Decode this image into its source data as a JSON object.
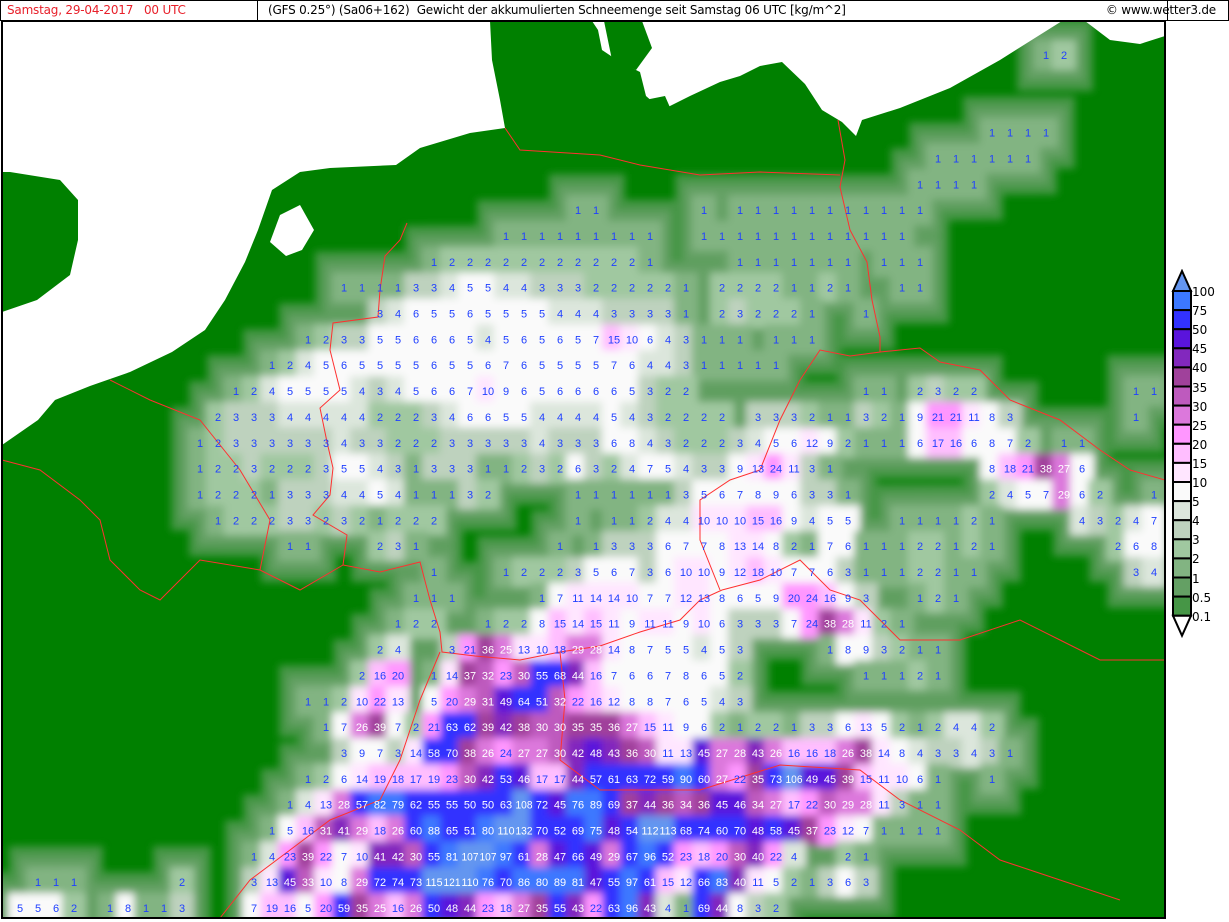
{
  "header": {
    "date": "Samstag, 29-04-2017   00 UTC",
    "title": "(GFS 0.25°) (Sa06+162)  Gewicht der akkumulierten Schneemenge seit Samstag 06 UTC [kg/m^2]",
    "copyright": "© www.wetter3.de"
  },
  "colors": {
    "land": "#008000",
    "sea": "#ffffff",
    "border": "#ff3030",
    "value_text": "#2040ff",
    "value_text_dark_bg": "#ffffff"
  },
  "legend": {
    "labels": [
      "100",
      "75",
      "50",
      "45",
      "40",
      "35",
      "30",
      "25",
      "20",
      "15",
      "10",
      "5",
      "4",
      "3",
      "2",
      "1",
      "0.5",
      "0.1"
    ],
    "thresholds": [
      0.1,
      0.5,
      1,
      2,
      3,
      4,
      5,
      10,
      15,
      20,
      25,
      30,
      35,
      40,
      45,
      50,
      75,
      100
    ],
    "class_colors": [
      "#469646",
      "#64a064",
      "#82b482",
      "#a0c8a0",
      "#bed2be",
      "#dce6dc",
      "#fafafa",
      "#ffe6ff",
      "#ffbeff",
      "#ff96ff",
      "#dc78dc",
      "#be5abe",
      "#a0419b",
      "#8228be",
      "#5a14dc",
      "#3232ff",
      "#3c78ff",
      "#6496f0"
    ],
    "below_min_color": "#ffffff",
    "unit": "kg/m^2"
  },
  "grid": {
    "note": "snow mass values per model grid cell, row by row north to south; ~N = N empty cells",
    "rows": [
      "~58 1 2",
      "",
      "",
      "~55 1 1 1 1",
      "~52 1 1 1 1 1 1",
      "~51 1 1 1 1",
      "~32 1 1 ~5 1 ~1 1 1 1 1 1 1 1 1 1 1 1",
      "~28 1 1 1 1 1 1 1 1 1 ~2 1 1 1 1 1 1 1 1 1 1 1 1",
      "~24 1 2 2 2 2 2 2 2 2 2 2 2 1 ~4 1 1 1 1 1 1 1 ~1 1 1 1",
      "~19 1 1 1 1 3 3 4 5 5 4 4 3 3 3 2 2 2 2 2 1 ~1 2 2 2 2 1 1 2 1 ~2 1 1",
      "~21 3 4 6 5 5 6 5 5 5 5 4 4 4 3 3 3 3 1 ~1 2 3 2 2 2 1 ~2 1",
      "~17 1 2 3 3 5 5 6 6 6 5 4 5 6 5 6 5 7 15 10 6 4 3 1 1 1 ~1 1 1 1",
      "~15 1 2 4 5 6 5 5 5 5 6 5 5 6 7 6 5 5 5 5 7 6 4 4 3 1 1 1 1 1",
      "~13 1 2 4 5 5 5 5 4 3 4 5 6 6 7 10 9 6 5 6 6 6 6 5 3 2 2 ~9 1 1 ~1 2 3 2 2 ~8 1 1",
      "~12 2 3 3 3 4 4 4 4 4 2 2 2 3 4 6 6 5 5 4 4 4 4 5 4 3 2 2 2 2 ~1 3 3 3 2 1 1 3 2 1 9 21 21 11 8 3 ~6 1",
      "~11 1 2 3 3 3 3 3 3 4 3 3 2 2 2 3 3 3 3 3 4 3 3 3 6 8 4 3 2 2 2 3 4 5 6 12 9 2 1 1 1 6 17 16 6 8 7 2 ~1 1 1",
      "~11 1 2 2 3 2 2 2 3 5 5 4 3 1 3 3 3 1 1 2 3 2 6 3 2 4 7 5 4 3 3 9 13 24 11 3 1 ~8 8 18 21 38 27 6",
      "~11 1 2 2 2 1 3 3 3 4 4 5 4 1 1 1 3 2 ~4 1 1 1 1 1 1 3 5 6 7 8 9 6 3 3 1 ~7 2 4 5 7 29 6 2 ~2 1",
      "~12 1 2 2 2 3 3 2 3 2 1 2 2 2 ~7 1 ~1 1 1 2 4 4 10 10 10 15 16 9 4 5 5 ~2 1 1 1 1 2 1 ~4 4 3 2 4 7",
      "~16 1 1 ~3 2 3 1 ~7 1 ~1 1 3 3 3 6 7 7 8 13 14 8 2 1 7 6 1 1 1 2 2 1 2 1 ~6 2 6 8",
      "~24 1 ~3 1 2 2 2 3 5 6 7 3 6 10 10 9 12 18 10 7 7 6 3 1 1 1 2 2 1 1 ~8 3 4",
      "~23 1 1 1 ~4 1 7 11 14 14 10 7 7 12 13 8 6 5 9 20 24 16 9 3 ~2 1 2 1",
      "~22 1 2 2 ~2 1 2 2 8 15 14 15 11 9 11 11 9 10 6 3 3 3 7 24 38 28 11 2 1",
      "~21 2 4 ~2 3 21 36 25 13 10 18 29 28 14 8 7 5 5 4 5 3 ~4 1 8 9 3 2 1 1",
      "~20 2 16 20 ~1 1 14 37 32 23 30 55 68 44 16 7 6 6 7 8 6 5 2 ~6 1 1 1 2 1",
      "~17 1 1 2 10 22 13 ~1 5 20 29 31 49 64 51 32 22 16 12 8 8 7 6 5 4 3",
      "~18 1 7 26 39 7 2 21 63 62 39 42 38 30 30 35 35 36 27 15 11 9 6 2 1 2 2 1 3 3 6 13 5 2 1 2 4 4 2",
      "~19 3 9 7 3 14 58 70 38 26 24 27 27 30 42 48 43 36 30 11 13 45 27 28 43 26 16 16 18 26 38 14 8 4 3 3 4 3 1",
      "~17 1 2 6 14 19 18 17 19 23 30 42 53 46 17 17 44 57 61 63 72 59 90 60 27 22 35 73 106 49 45 39 15 11 10 6 1 ~2 1",
      "~16 1 4 13 28 57 82 79 62 55 55 50 50 63 108 72 45 76 89 69 37 44 36 34 36 45 46 34 27 17 22 30 29 28 11 3 1 1",
      "~15 1 5 16 31 41 29 18 26 60 88 65 51 80 110 132 70 52 69 75 48 54 112 113 68 74 60 70 48 58 45 37 23 12 7 1 1 1 1",
      "~14 1 4 23 39 22 7 10 41 42 30 55 81 107 107 97 61 28 47 66 49 29 67 96 52 23 18 20 30 40 22 4 ~2 2 1",
      "~2 1 1 1 ~5 2 ~3 3 13 45 33 10 8 29 72 74 73 115 121 110 76 70 86 80 89 81 47 55 97 61 15 12 66 83 40 11 5 2 1 3 6 3",
      "~1 5 5 6 2 ~1 1 8 1 1 3 ~3 7 19 16 5 20 59 35 25 16 26 50 48 44 23 18 27 35 55 43 22 63 96 43 4 1 69 44 8 3 2"
    ]
  }
}
